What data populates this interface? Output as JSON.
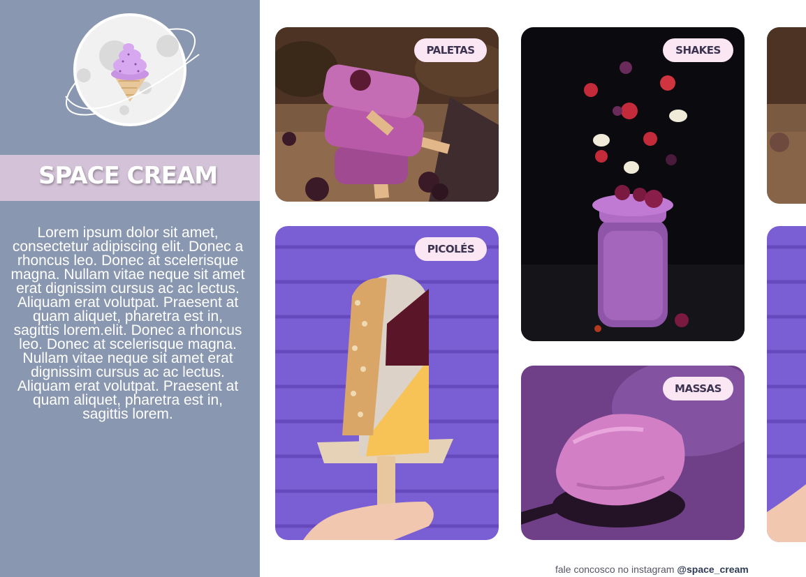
{
  "brand": {
    "name": "SPACE CREAM",
    "logo_icon": "ice-cream-planet-logo"
  },
  "about": {
    "text": "Lorem ipsum dolor sit amet, consectetur adipiscing elit. Donec a rhoncus leo. Donec at scelerisque magna. Nullam vitae neque sit amet erat dignissim cursus ac ac lectus. Aliquam erat volutpat. Praesent at quam aliquet, pharetra est in, sagittis lorem.elit. Donec a rhoncus leo. Donec at scelerisque magna. Nullam vitae neque sit amet erat dignissim cursus ac ac lectus. Aliquam erat volutpat. Praesent at quam aliquet, pharetra est in, sagittis lorem."
  },
  "categories": [
    {
      "label": "PALETAS",
      "image": "purple-paletas-with-blackberries"
    },
    {
      "label": "SHAKES",
      "image": "purple-shake-jar-with-flying-fruit"
    },
    {
      "label": "PICOLÉS",
      "image": "popsicle-with-nuts-against-purple-brick-wall"
    },
    {
      "label": "MASSAS",
      "image": "scoop-of-purple-ice-cream"
    }
  ],
  "footer": {
    "text": "fale concosco no instagram",
    "handle": "@space_cream"
  },
  "colors": {
    "sidebar": "#8a97b0",
    "brand_band": "#d4c3d8",
    "pill": "#fbe6f4",
    "pill_text": "#3c3350"
  }
}
